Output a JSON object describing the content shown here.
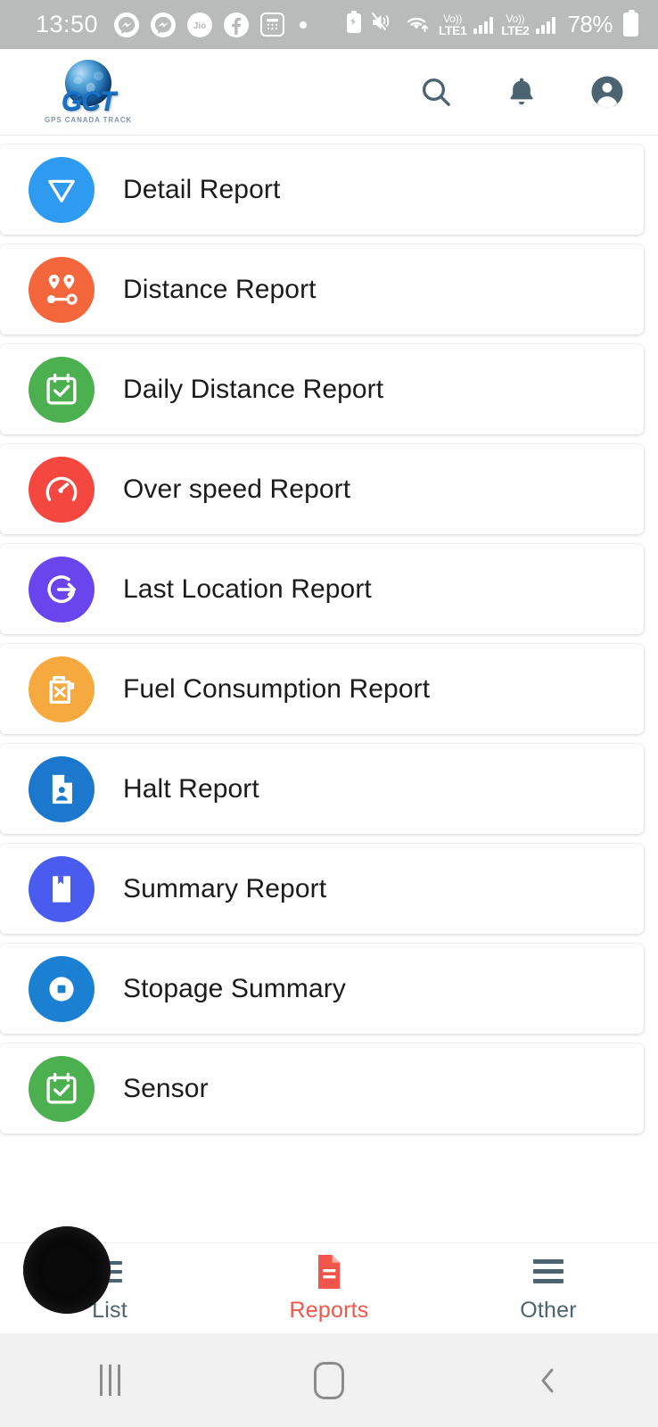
{
  "status_bar": {
    "time": "13:50",
    "left_icons": [
      "messenger-icon",
      "messenger-icon",
      "jio-icon",
      "facebook-icon",
      "calculator-icon",
      "dot-indicator"
    ],
    "right_icons": [
      "battery-saver-icon",
      "vibrate-mute-icon",
      "wifi-icon"
    ],
    "sim1": {
      "volte": "Vo))",
      "network": "LTE1"
    },
    "sim2": {
      "volte": "Vo))",
      "network": "LTE2"
    },
    "battery_percent": "78%"
  },
  "header": {
    "logo_text": "GCT",
    "logo_subtitle": "GPS CANADA TRACK",
    "actions": [
      {
        "name": "search-icon",
        "label": "Search"
      },
      {
        "name": "notifications-bell-icon",
        "label": "Notifications"
      },
      {
        "name": "account-circle-icon",
        "label": "Account"
      }
    ],
    "icon_color": "#4c6472"
  },
  "reports": {
    "items": [
      {
        "label": "Detail Report",
        "icon": "funnel-triangle-icon",
        "color": "#2e9bf0"
      },
      {
        "label": "Distance Report",
        "icon": "route-pins-icon",
        "color": "#f4663c"
      },
      {
        "label": "Daily Distance Report",
        "icon": "calendar-check-icon",
        "color": "#4caf50"
      },
      {
        "label": "Over speed Report",
        "icon": "speedometer-icon",
        "color": "#f4473f"
      },
      {
        "label": "Last Location Report",
        "icon": "location-exit-icon",
        "color": "#6a45ed"
      },
      {
        "label": "Fuel Consumption Report",
        "icon": "fuel-can-icon",
        "color": "#f5a93f"
      },
      {
        "label": "Halt Report",
        "icon": "document-person-icon",
        "color": "#1b78cc"
      },
      {
        "label": "Summary Report",
        "icon": "bookmark-book-icon",
        "color": "#4a5bf0"
      },
      {
        "label": "Stopage Summary",
        "icon": "stop-circle-icon",
        "color": "#1b80d2"
      },
      {
        "label": "Sensor",
        "icon": "calendar-check-icon",
        "color": "#4caf50"
      }
    ]
  },
  "tab_bar": {
    "active": "Reports",
    "active_color": "#f2564a",
    "inactive_color": "#4c6472",
    "tabs": [
      {
        "label": "List",
        "icon": "list-lines-icon"
      },
      {
        "label": "Reports",
        "icon": "report-document-icon"
      },
      {
        "label": "Other",
        "icon": "hamburger-menu-icon"
      }
    ]
  },
  "nav_bar": {
    "buttons": [
      {
        "name": "recents-button",
        "label": "Recents"
      },
      {
        "name": "home-button",
        "label": "Home"
      },
      {
        "name": "back-button",
        "label": "Back"
      }
    ]
  }
}
